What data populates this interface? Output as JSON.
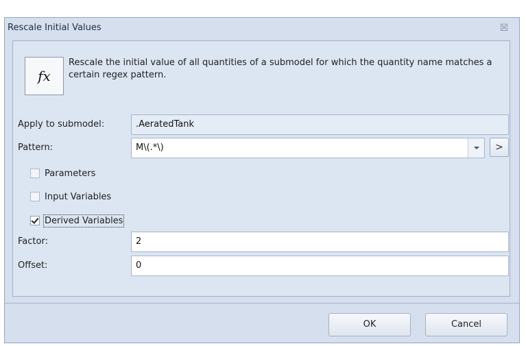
{
  "window": {
    "title": "Rescale Initial Values",
    "close_glyph": "☒"
  },
  "header": {
    "icon_label": "fx",
    "description": "Rescale the initial value of all quantities of a submodel for which the quantity name matches a certain regex pattern."
  },
  "form": {
    "submodel": {
      "label": "Apply to submodel:",
      "value": ".AeratedTank"
    },
    "pattern": {
      "label": "Pattern:",
      "value": "M\\(.*\\)",
      "arrow_label": ">"
    },
    "checkboxes": [
      {
        "label": "Parameters",
        "checked": false
      },
      {
        "label": "Input Variables",
        "checked": false
      },
      {
        "label": "Derived Variables",
        "checked": true
      }
    ],
    "factor": {
      "label": "Factor:",
      "value": "2"
    },
    "offset": {
      "label": "Offset:",
      "value": "0"
    }
  },
  "buttons": {
    "ok": "OK",
    "cancel": "Cancel"
  },
  "icons": {
    "fx": "fx-icon",
    "close": "close-icon",
    "dropdown": "chevron-down-icon"
  },
  "colors": {
    "dialog_bg": "#d5dfee",
    "panel_bg": "#dce6f3",
    "border": "#93a6c1"
  }
}
